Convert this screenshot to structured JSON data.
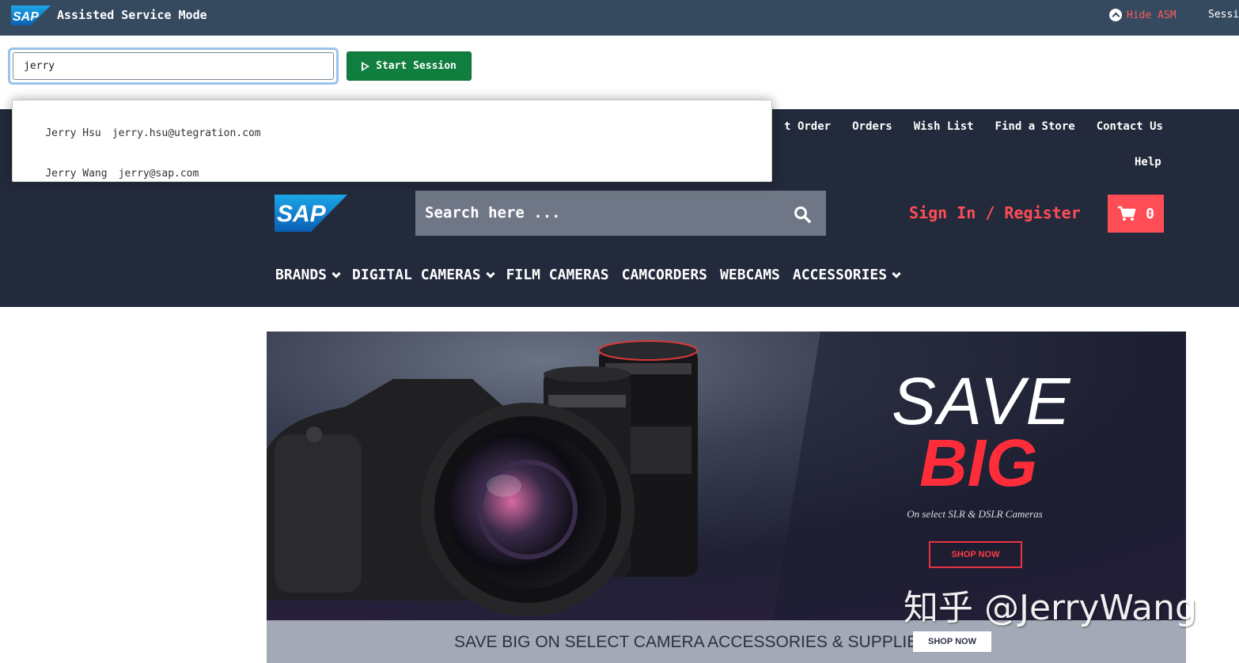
{
  "asm": {
    "title": "Assisted Service Mode",
    "hide_label": "Hide ASM",
    "session_label": "Sessi",
    "customer_input_value": "jerry",
    "start_session_label": "Start Session",
    "suggestions": [
      {
        "name": "Jerry Hsu",
        "email": "jerry.hsu@utegration.com"
      },
      {
        "name": "Jerry Wang",
        "email": "jerry@sap.com"
      }
    ]
  },
  "header": {
    "util_nav": [
      "t Order",
      "Orders",
      "Wish List",
      "Find a Store",
      "Contact Us"
    ],
    "help": "Help",
    "search_placeholder": "Search here ...",
    "signin": "Sign In / Register",
    "cart_count": "0",
    "main_nav": [
      {
        "label": "BRANDS",
        "dropdown": true
      },
      {
        "label": "DIGITAL CAMERAS",
        "dropdown": true
      },
      {
        "label": "FILM CAMERAS",
        "dropdown": false
      },
      {
        "label": "CAMCORDERS",
        "dropdown": false
      },
      {
        "label": "WEBCAMS",
        "dropdown": false
      },
      {
        "label": "ACCESSORIES",
        "dropdown": true
      }
    ]
  },
  "banner": {
    "headline_1": "SAVE",
    "headline_2": "BIG",
    "subtitle": "On select SLR & DSLR Cameras",
    "shop_now": "SHOP NOW",
    "strip_text": "SAVE BIG ON SELECT CAMERA ACCESSORIES & SUPPLIES",
    "strip_shop_now": "SHOP NOW"
  },
  "watermark": "知乎 @JerryWang",
  "colors": {
    "asm_bar": "#354a5f",
    "header_bg": "#232a3b",
    "accent_red": "#ff4d55",
    "start_green": "#107e3e"
  },
  "icons": [
    "sap-logo-icon",
    "chevron-up-circle-icon",
    "play-icon",
    "search-icon",
    "cart-icon",
    "chevron-down-icon"
  ]
}
